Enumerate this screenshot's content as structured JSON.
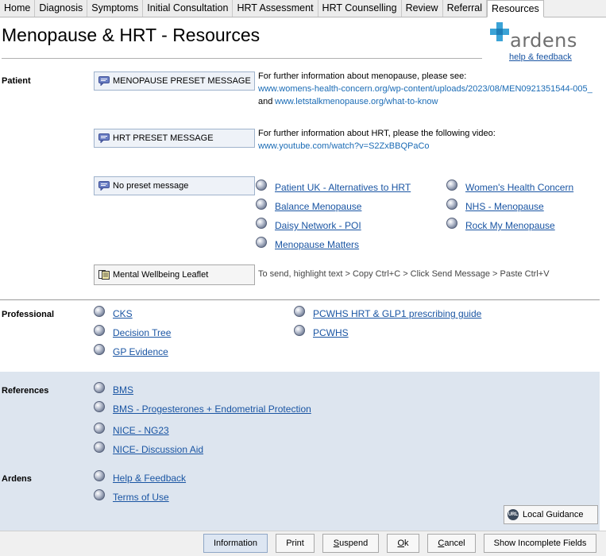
{
  "tabs": [
    {
      "label": "Home"
    },
    {
      "label": "Diagnosis"
    },
    {
      "label": "Symptoms"
    },
    {
      "label": "Initial Consultation"
    },
    {
      "label": "HRT Assessment"
    },
    {
      "label": "HRT Counselling"
    },
    {
      "label": "Review"
    },
    {
      "label": "Referral"
    },
    {
      "label": "Resources",
      "active": true
    }
  ],
  "header": {
    "title": "Menopause & HRT - Resources",
    "logo_text": "ardens",
    "help_link": "help & feedback"
  },
  "colors": {
    "link": "#1a55a3",
    "url": "#1a6bb5",
    "accent_bg": "#dde5ef",
    "logo": "#3ba3d6"
  },
  "patient": {
    "label": "Patient",
    "preset1": {
      "label": "MENOPAUSE PRESET MESSAGE",
      "info": "For further information about menopause, please see:",
      "url1": "www.womens-health-concern.org/wp-content/uploads/2023/08/MEN0921351544-005_",
      "and": "and",
      "url2": "www.letstalkmenopause.org/what-to-know"
    },
    "preset2": {
      "label": "HRT PRESET MESSAGE",
      "info": "For further information about HRT, please the following video:",
      "url1": "www.youtube.com/watch?v=S2ZxBBQPaCo"
    },
    "preset3": {
      "label": "No preset message"
    },
    "links_col1": [
      "Patient UK - Alternatives to HRT",
      "Balance Menopause",
      "Daisy Network - POI",
      "Menopause Matters"
    ],
    "links_col2": [
      "Women's Health Concern",
      "NHS - Menopause",
      "Rock My Menopause"
    ],
    "leaflet": {
      "label": "Mental Wellbeing Leaflet",
      "note": "To send, highlight text > Copy Ctrl+C > Click Send Message > Paste Ctrl+V"
    }
  },
  "professional": {
    "label": "Professional",
    "links_col1": [
      "CKS",
      "Decision Tree",
      "GP Evidence"
    ],
    "links_col2": [
      "PCWHS HRT & GLP1 prescribing guide",
      "PCWHS"
    ]
  },
  "references": {
    "label": "References",
    "links": [
      "BMS",
      "BMS - Progesterones + Endometrial Protection",
      "NICE - NG23",
      "NICE- Discussion Aid"
    ]
  },
  "ardens": {
    "label": "Ardens",
    "links": [
      "Help & Feedback",
      "Terms of Use"
    ]
  },
  "local_guidance": {
    "badge": "URL",
    "label": "Local Guidance"
  },
  "buttons": {
    "information": "Information",
    "print": "Print",
    "suspend_first": "S",
    "suspend_rest": "uspend",
    "ok_first": "O",
    "ok_rest": "k",
    "cancel_first": "C",
    "cancel_rest": "ancel",
    "show_incomplete": "Show Incomplete Fields"
  }
}
